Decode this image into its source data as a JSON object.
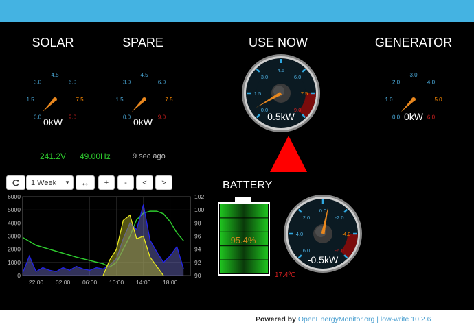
{
  "footer": {
    "prefix": "Powered by ",
    "link": "OpenEnergyMonitor.org",
    "sep": " | ",
    "version": "low-write 10.2.6"
  },
  "gauges": {
    "solar": {
      "title": "SOLAR",
      "readout": "0kW",
      "value": 0
    },
    "spare": {
      "title": "SPARE",
      "readout": "0kW",
      "value": 0
    },
    "use_now": {
      "title": "USE NOW",
      "readout": "0.5kW",
      "value": 0.5
    },
    "generator": {
      "title": "GENERATOR",
      "readout": "0kW",
      "value": 0
    },
    "battery": {
      "readout": "-0.5kW",
      "value": -0.5
    }
  },
  "gauge_scales": {
    "standard": [
      "0.0",
      "1.5",
      "3.0",
      "4.5",
      "6.0",
      "7.5",
      "9.0"
    ],
    "generator": [
      "0.0",
      "1.0",
      "2.0",
      "3.0",
      "4.0",
      "5.0",
      "6.0"
    ],
    "battery": [
      "6.0",
      "4.0",
      "2.0",
      "0.0",
      "-2.0",
      "-4.0",
      "-6.0"
    ]
  },
  "status": {
    "voltage": "241.2V",
    "frequency": "49.00Hz",
    "updated": "9 sec ago"
  },
  "toolbar": {
    "range": "1 Week",
    "zoom_in": "+",
    "zoom_out": "-",
    "prev": "<",
    "next": ">"
  },
  "battery_panel": {
    "title": "BATTERY",
    "charge": "95.4%",
    "charge_value": 95.4,
    "temperature": "17.4ºC"
  },
  "colors": {
    "accent": "#44b3e2",
    "voltage": "#2ecc2e",
    "frequency": "#2ecc2e",
    "alert": "#ff0000",
    "temp": "#d42020"
  },
  "chart_data": {
    "type": "line",
    "x_ticks": [
      "22:00",
      "02:00",
      "06:00",
      "10:00",
      "14:00",
      "18:00"
    ],
    "y_left_ticks": [
      "0",
      "1000",
      "2000",
      "3000",
      "4000",
      "5000",
      "6000"
    ],
    "y_right_ticks": [
      "90",
      "92",
      "94",
      "96",
      "98",
      "100",
      "102"
    ],
    "ylim_left": [
      0,
      6000
    ],
    "ylim_right": [
      90,
      102
    ],
    "series": [
      {
        "color": "#2ecc2e",
        "axis": "right",
        "x": [
          20,
          22,
          24,
          26,
          28,
          30,
          32,
          33,
          34,
          35,
          36,
          37,
          38,
          39,
          40,
          41,
          42,
          43,
          44
        ],
        "y": [
          95.8,
          94.6,
          94.0,
          93.4,
          92.8,
          92.3,
          91.8,
          91.3,
          92.0,
          94.0,
          96.0,
          98.5,
          99.5,
          99.8,
          99.8,
          99.4,
          98.2,
          96.5,
          95.3
        ]
      },
      {
        "color": "#2222ee",
        "axis": "left",
        "x": [
          20,
          21,
          22,
          23,
          24,
          25,
          26,
          27,
          28,
          29,
          30,
          31,
          32,
          33,
          34,
          35,
          36,
          37,
          38,
          39,
          40,
          41,
          42,
          43,
          44
        ],
        "y": [
          200,
          1500,
          300,
          600,
          400,
          300,
          600,
          400,
          700,
          500,
          400,
          600,
          500,
          800,
          1300,
          2800,
          4000,
          3500,
          5400,
          2700,
          1800,
          1000,
          1500,
          2200,
          500
        ]
      },
      {
        "color": "#e8e820",
        "axis": "left",
        "x": [
          32,
          33,
          34,
          35,
          36,
          37,
          38,
          39,
          40,
          41
        ],
        "y": [
          0,
          1200,
          2000,
          4200,
          4600,
          2800,
          3000,
          1400,
          700,
          0
        ]
      }
    ]
  }
}
